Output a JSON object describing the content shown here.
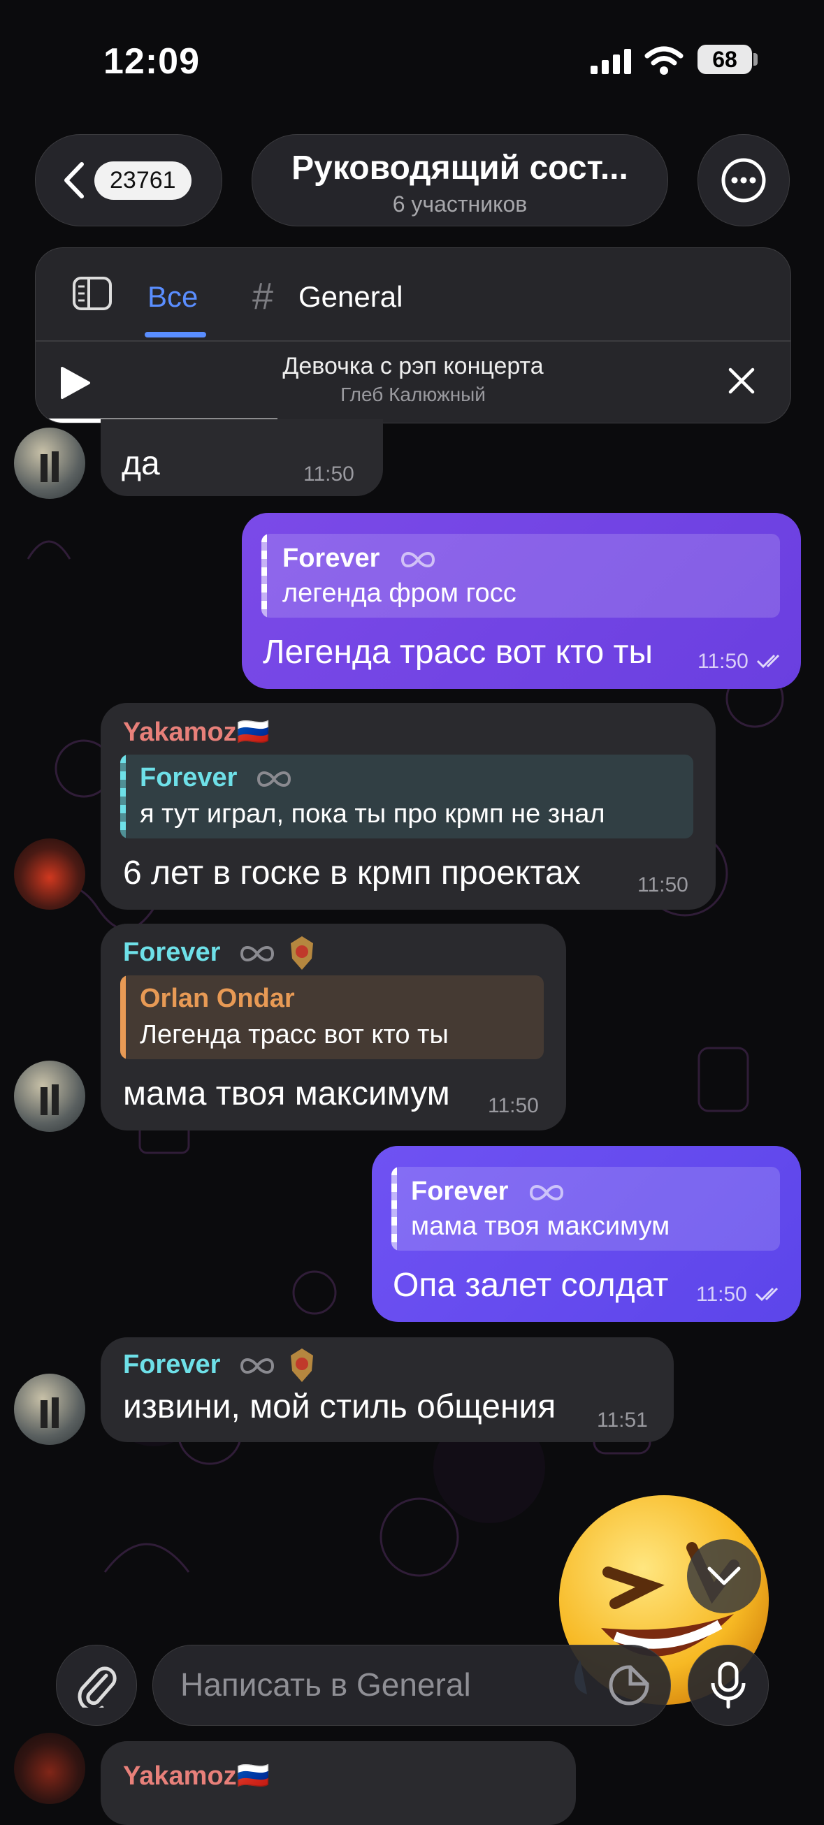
{
  "status_bar": {
    "time": "12:09",
    "battery": "68"
  },
  "header": {
    "unread_count": "23761",
    "title": "Руководящий сост...",
    "subtitle": "6 участников"
  },
  "tabs": {
    "all": "Все",
    "hash": "#",
    "general": "General"
  },
  "player": {
    "title": "Девочка с рэп концерта",
    "artist": "Глеб Калюжный",
    "progress": 0.32
  },
  "messages": [
    {
      "text": "да",
      "time": "11:50"
    },
    {
      "reply_name": "Forever",
      "reply_text": "легенда фром госс",
      "text": "Легенда трасс вот кто ты",
      "time": "11:50"
    },
    {
      "sender": "Yakamoz🇷🇺",
      "reply_name": "Forever",
      "reply_text": "я тут играл, пока ты про крмп не знал",
      "text": "6 лет в госке в крмп проектах",
      "time": "11:50"
    },
    {
      "sender": "Forever",
      "reply_name": "Orlan Ondar",
      "reply_text": "Легенда трасс вот кто ты",
      "text": "мама твоя максимум",
      "time": "11:50"
    },
    {
      "reply_name": "Forever",
      "reply_text": "мама твоя максимум",
      "text": "Опа залет солдат",
      "time": "11:50"
    },
    {
      "sender": "Forever",
      "text": "извини, мой стиль общения",
      "time": "11:51"
    }
  ],
  "peek_sender": "Yakamoz🇷🇺",
  "composer": {
    "placeholder": "Написать в General"
  },
  "colors": {
    "accent": "#5a8eff",
    "out_bubble": "#7b4ae8",
    "in_bubble": "#2a2a2e",
    "forever_name": "#6ee0e8",
    "yakamoz_name": "#e8807a",
    "orlan_name": "#e89a55"
  },
  "icons": [
    "back-chevron-icon",
    "more-icon",
    "sidebar-icon",
    "play-icon",
    "close-icon",
    "infinity-icon",
    "emblem-icon",
    "attach-icon",
    "sticker-icon",
    "mic-icon",
    "chevron-down-icon",
    "double-check-icon"
  ]
}
